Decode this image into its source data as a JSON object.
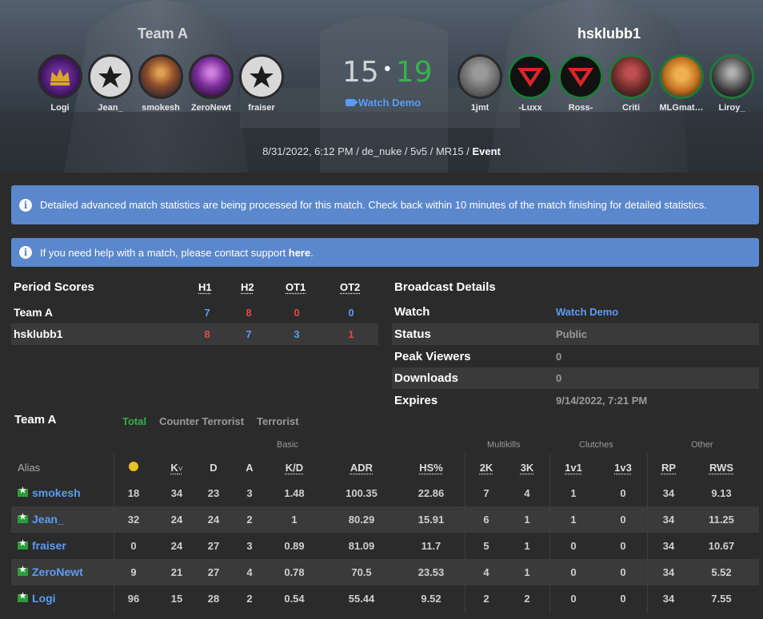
{
  "team_a": {
    "name": "Team A",
    "players": [
      "Logi",
      "Jean_",
      "smokesh",
      "ZeroNewt",
      "fraiser"
    ]
  },
  "team_b": {
    "name": "hsklubb1",
    "players": [
      "1jmt",
      "-Luxx",
      "Ross-",
      "Criti",
      "MLGmat…",
      "Liroy_"
    ]
  },
  "score": {
    "team_a": "15",
    "separator": "•",
    "team_b": "19"
  },
  "hero_watch_demo": "Watch Demo",
  "meta": {
    "info": "8/31/2022, 6:12 PM / de_nuke / 5v5 / MR15 / ",
    "event": "Event"
  },
  "alerts": {
    "processing": "Detailed advanced match statistics are being processed for this match. Check back within 10 minutes of the match finishing for detailed statistics.",
    "help_prefix": "If you need help with a match, please contact support ",
    "help_link": "here",
    "help_suffix": "."
  },
  "period_scores": {
    "title": "Period Scores",
    "headers": [
      "H1",
      "H2",
      "OT1",
      "OT2"
    ],
    "rows": [
      {
        "team": "Team A",
        "values": [
          "7",
          "8",
          "0",
          "0"
        ]
      },
      {
        "team": "hsklubb1",
        "values": [
          "8",
          "7",
          "3",
          "1"
        ]
      }
    ]
  },
  "broadcast": {
    "title": "Broadcast Details",
    "rows": [
      {
        "key": "Watch",
        "value": "Watch Demo"
      },
      {
        "key": "Status",
        "value": "Public"
      },
      {
        "key": "Peak Viewers",
        "value": "0"
      },
      {
        "key": "Downloads",
        "value": "0"
      },
      {
        "key": "Expires",
        "value": "9/14/2022, 7:21 PM"
      }
    ]
  },
  "stats": {
    "team": "Team A",
    "tabs": [
      "Total",
      "Counter Terrorist",
      "Terrorist"
    ],
    "groups": [
      "Basic",
      "Multikills",
      "Clutches",
      "Other"
    ],
    "columns": [
      "Alias",
      "",
      "K",
      "D",
      "A",
      "K/D",
      "ADR",
      "HS%",
      "2K",
      "3K",
      "1v1",
      "1v3",
      "RP",
      "RWS"
    ],
    "k_sort": "˅",
    "rows": [
      [
        "smokesh",
        "18",
        "34",
        "23",
        "3",
        "1.48",
        "100.35",
        "22.86",
        "7",
        "4",
        "1",
        "0",
        "34",
        "9.13"
      ],
      [
        "Jean_",
        "32",
        "24",
        "24",
        "2",
        "1",
        "80.29",
        "15.91",
        "6",
        "1",
        "1",
        "0",
        "34",
        "11.25"
      ],
      [
        "fraiser",
        "0",
        "24",
        "27",
        "3",
        "0.89",
        "81.09",
        "11.7",
        "5",
        "1",
        "0",
        "0",
        "34",
        "10.67"
      ],
      [
        "ZeroNewt",
        "9",
        "21",
        "27",
        "4",
        "0.78",
        "70.5",
        "23.53",
        "4",
        "1",
        "0",
        "0",
        "34",
        "5.52"
      ],
      [
        "Logi",
        "96",
        "15",
        "28",
        "2",
        "0.54",
        "55.44",
        "9.52",
        "2",
        "2",
        "0",
        "0",
        "34",
        "7.55"
      ]
    ]
  },
  "colors": {
    "accent_blue": "#5a9cf5",
    "win_green": "#35b34a",
    "loss_red": "#e3484b",
    "alert_bg": "#5b87cc"
  }
}
